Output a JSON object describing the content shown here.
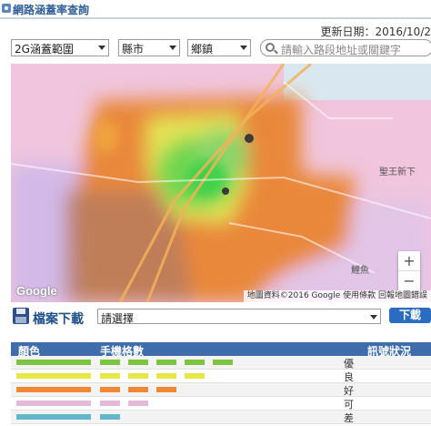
{
  "header": {
    "title": "網路涵蓋率查詢"
  },
  "updated": "更新日期：2016/10/2",
  "controls": {
    "coverage_select": "2G涵蓋範圍",
    "county_select": "縣市",
    "town_select": "鄉鎮",
    "search_placeholder": "請輸入路段地址或關鍵字"
  },
  "map": {
    "place_label_1": "聖王新下",
    "place_label_2": "鯉魚",
    "attribution": "地圖資料©2016 Google   使用條款   回報地圖錯誤",
    "logo": "Google",
    "zoom_in": "+",
    "zoom_out": "−"
  },
  "download": {
    "label": "檔案下載",
    "select_value": "請選擇",
    "button": "下載"
  },
  "legend": {
    "headers": {
      "color": "顏色",
      "bars": "手機格數",
      "status": "訊號狀況"
    },
    "rows": [
      {
        "color": "#7cc540",
        "bar_count": 5,
        "status": "優"
      },
      {
        "color": "#e6e645",
        "bar_count": 4,
        "status": "良"
      },
      {
        "color": "#ef8833",
        "bar_count": 3,
        "status": "好"
      },
      {
        "color": "#e3b9d8",
        "bar_count": 2,
        "status": "可"
      },
      {
        "color": "#62b6c9",
        "bar_count": 1,
        "status": "差"
      }
    ]
  }
}
